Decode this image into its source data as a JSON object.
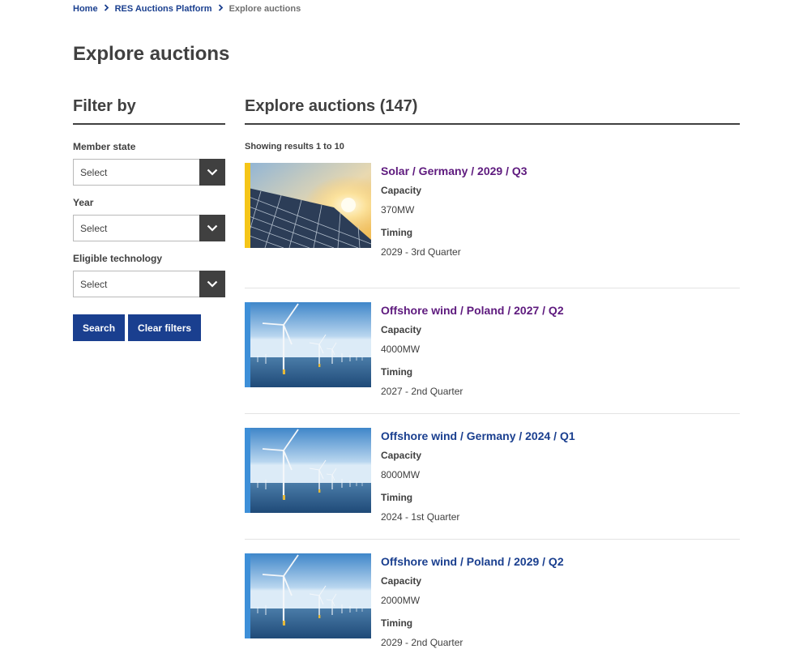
{
  "breadcrumb": {
    "items": [
      "Home",
      "RES Auctions Platform"
    ],
    "current": "Explore auctions",
    "separator": ">"
  },
  "page_title": "Explore auctions",
  "filters": {
    "title": "Filter by",
    "fields": [
      {
        "label": "Member state",
        "value": "Select"
      },
      {
        "label": "Year",
        "value": "Select"
      },
      {
        "label": "Eligible technology",
        "value": "Select"
      }
    ],
    "search_label": "Search",
    "clear_label": "Clear filters"
  },
  "results": {
    "title": "Explore auctions (147)",
    "showing": "Showing results 1 to 10",
    "capacity_label": "Capacity",
    "timing_label": "Timing",
    "items": [
      {
        "title": "Solar / Germany / 2029 / Q3",
        "capacity": "370MW",
        "timing": "2029 - 3rd Quarter",
        "image": "solar-panels",
        "stripe_color": "#f5c518",
        "visited": true
      },
      {
        "title": "Offshore wind / Poland / 2027 / Q2",
        "capacity": "4000MW",
        "timing": "2027 - 2nd Quarter",
        "image": "offshore-wind-turbines",
        "stripe_color": "#3d8fd8",
        "visited": true
      },
      {
        "title": "Offshore wind / Germany / 2024 / Q1",
        "capacity": "8000MW",
        "timing": "2024 - 1st Quarter",
        "image": "offshore-wind-turbines",
        "stripe_color": "#3d8fd8",
        "visited": false
      },
      {
        "title": "Offshore wind / Poland / 2029 / Q2",
        "capacity": "2000MW",
        "timing": "2029 - 2nd Quarter",
        "image": "offshore-wind-turbines",
        "stripe_color": "#3d8fd8",
        "visited": false
      }
    ]
  },
  "colors": {
    "link": "#1a3f8f",
    "visited_link": "#5e1a7e",
    "button_bg": "#1a3f8f",
    "select_arrow_bg": "#404040"
  }
}
